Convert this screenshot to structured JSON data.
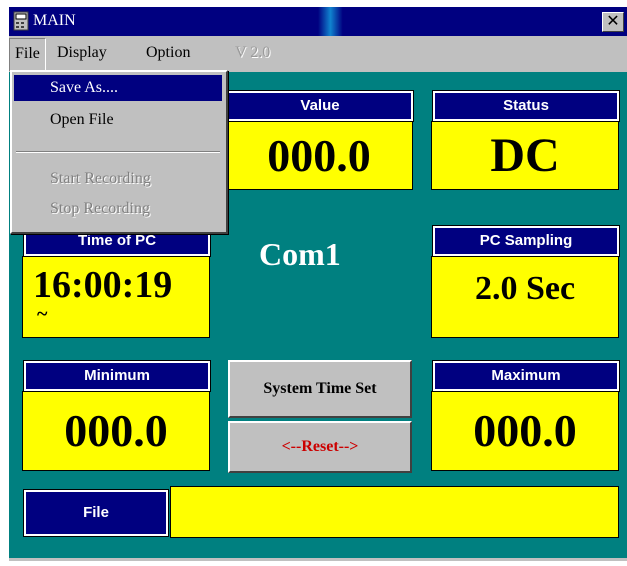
{
  "window": {
    "title": "MAIN",
    "close_glyph": "✕"
  },
  "menu": {
    "file": "File",
    "display": "Display",
    "option": "Option",
    "version": "V 2.0"
  },
  "file_menu": {
    "items": [
      "Save As....",
      "Open File",
      "Start Recording",
      "Stop Recording"
    ]
  },
  "panels": {
    "value": {
      "label": "Value",
      "reading": "000.0"
    },
    "status": {
      "label": "Status",
      "reading": "DC"
    },
    "time_pc": {
      "label": "Time of PC",
      "reading": "16:00:19",
      "sub": "~"
    },
    "port": "Com1",
    "pc_sampling": {
      "label": "PC Sampling",
      "reading": "2.0 Sec"
    },
    "minimum": {
      "label": "Minimum",
      "reading": "000.0"
    },
    "maximum": {
      "label": "Maximum",
      "reading": "000.0"
    }
  },
  "buttons": {
    "system_time_set": "System Time Set",
    "reset": "<--Reset-->"
  },
  "file_bar": {
    "label": "File",
    "value": ""
  },
  "colors": {
    "background": "#008080",
    "header": "#000080",
    "display": "#ffff00",
    "reset_text": "#cc0000"
  },
  "icons": {
    "app": "meter-app-icon",
    "close": "close-icon"
  }
}
